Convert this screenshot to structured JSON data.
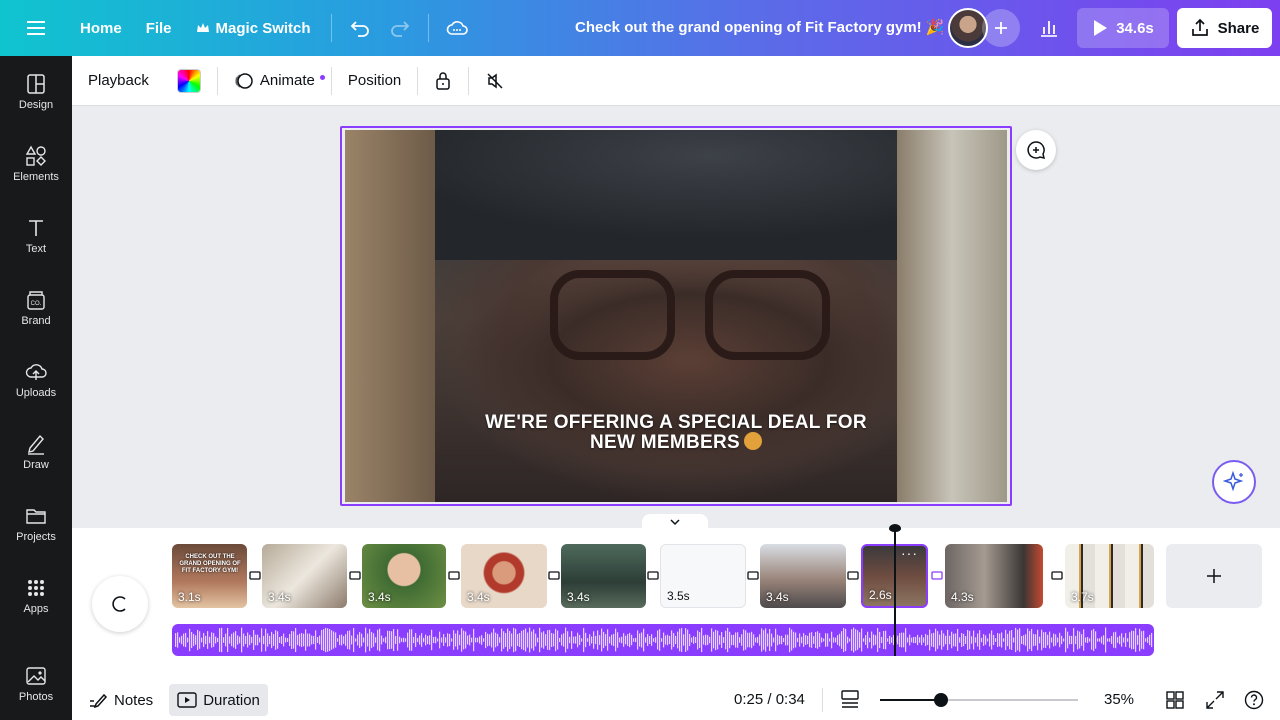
{
  "topbar": {
    "home": "Home",
    "file": "File",
    "magic_switch": "Magic Switch",
    "title": "Check out the grand opening of Fit Factory gym! 🎉",
    "play_duration": "34.6s",
    "share": "Share",
    "icons": [
      "menu-icon",
      "crown-icon",
      "undo-icon",
      "redo-icon",
      "cloud-icon",
      "plus-icon",
      "bar-chart-icon",
      "play-icon",
      "share-upload-icon"
    ]
  },
  "sidebar": {
    "items": [
      {
        "label": "Design",
        "icon": "layout-icon"
      },
      {
        "label": "Elements",
        "icon": "shapes-icon"
      },
      {
        "label": "Text",
        "icon": "text-icon"
      },
      {
        "label": "Brand",
        "icon": "brand-icon"
      },
      {
        "label": "Uploads",
        "icon": "upload-cloud-icon"
      },
      {
        "label": "Draw",
        "icon": "pen-icon"
      },
      {
        "label": "Projects",
        "icon": "folder-icon"
      },
      {
        "label": "Apps",
        "icon": "grid-icon"
      },
      {
        "label": "Photos",
        "icon": "image-icon"
      }
    ]
  },
  "toolbar": {
    "playback": "Playback",
    "animate": "Animate",
    "position": "Position"
  },
  "canvas": {
    "caption_line1": "WE'RE OFFERING A SPECIAL DEAL FOR",
    "caption_line2": "NEW MEMBERS"
  },
  "timeline": {
    "clips": [
      {
        "duration": "3.1s",
        "overlay": "CHECK OUT THE GRAND OPENING OF FIT FACTORY GYM!"
      },
      {
        "duration": "3.4s"
      },
      {
        "duration": "3.4s"
      },
      {
        "duration": "3.4s"
      },
      {
        "duration": "3.4s"
      },
      {
        "duration": "3.5s"
      },
      {
        "duration": "3.4s"
      },
      {
        "duration": "2.6s",
        "selected": true
      },
      {
        "duration": "4.3s"
      },
      {
        "duration": "3.7s"
      }
    ]
  },
  "footer": {
    "notes": "Notes",
    "duration": "Duration",
    "time": "0:25 / 0:34",
    "zoom": "35%",
    "zoom_level_fraction": 0.31
  },
  "colors": {
    "accent": "#8b3dff",
    "sidebar_bg": "#18191b",
    "topbar_gradient_start": "#10c4cf",
    "topbar_gradient_end": "#7d3ff0"
  }
}
